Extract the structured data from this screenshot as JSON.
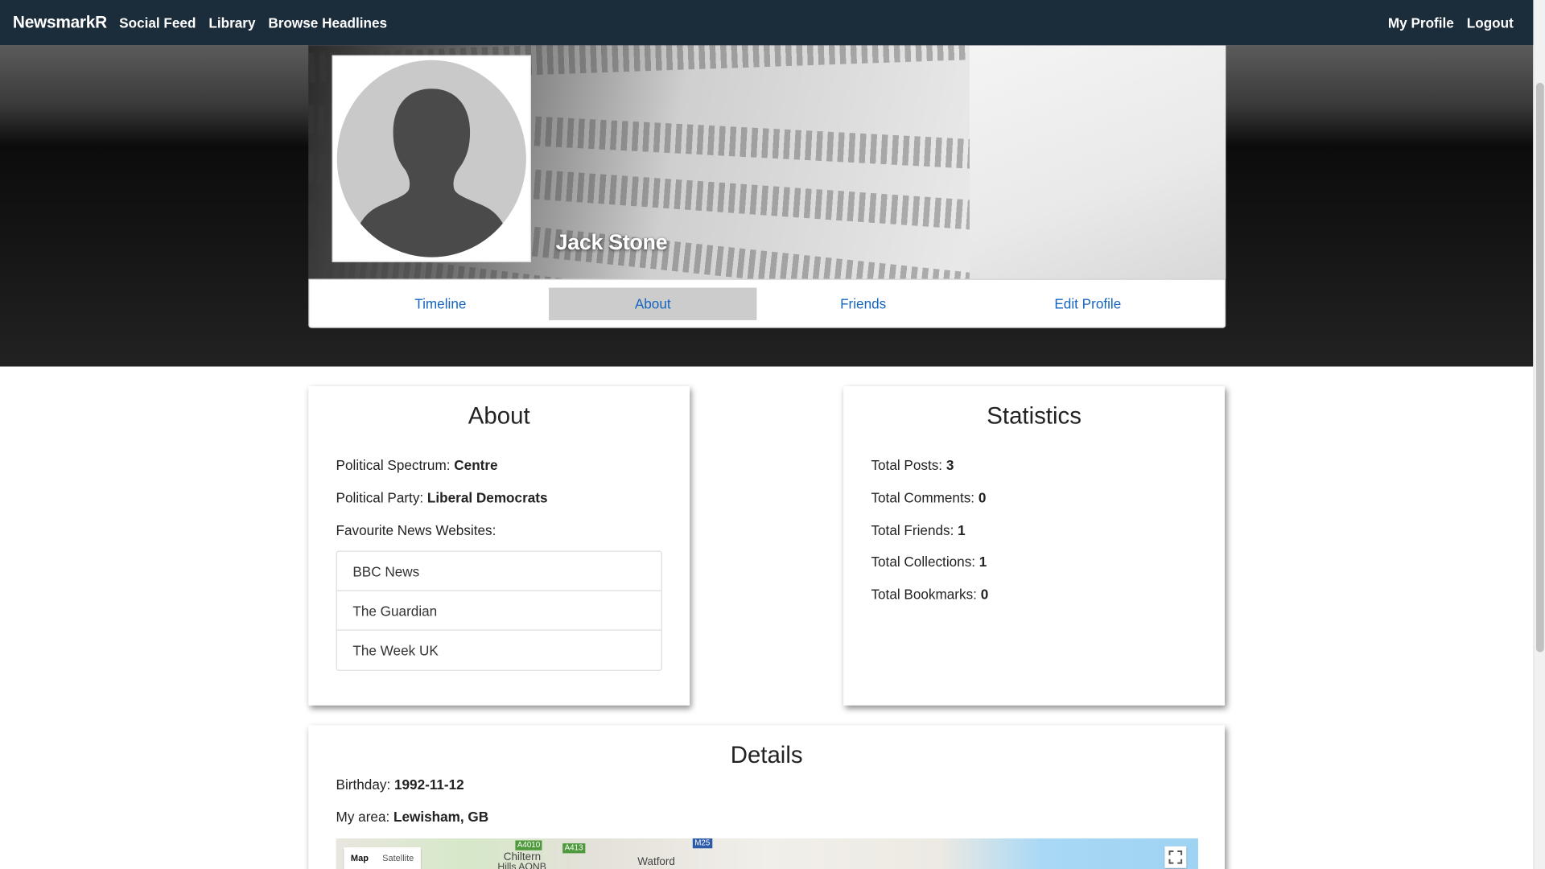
{
  "navbar": {
    "brand": "NewsmarkR",
    "left_links": [
      "Social Feed",
      "Library",
      "Browse Headlines"
    ],
    "right_links": [
      "My Profile",
      "Logout"
    ]
  },
  "profile": {
    "name": "Jack Stone"
  },
  "tabs": [
    "Timeline",
    "About",
    "Friends",
    "Edit Profile"
  ],
  "active_tab": "About",
  "about": {
    "title": "About",
    "political_spectrum_label": "Political Spectrum:",
    "political_spectrum_value": "Centre",
    "political_party_label": "Political Party:",
    "political_party_value": "Liberal Democrats",
    "favourite_sites_label": "Favourite News Websites:",
    "favourite_sites": [
      "BBC News",
      "The Guardian",
      "The Week UK"
    ]
  },
  "statistics": {
    "title": "Statistics",
    "items": [
      {
        "label": "Total Posts:",
        "value": "3"
      },
      {
        "label": "Total Comments:",
        "value": "0"
      },
      {
        "label": "Total Friends:",
        "value": "1"
      },
      {
        "label": "Total Collections:",
        "value": "1"
      },
      {
        "label": "Total Bookmarks:",
        "value": "0"
      }
    ]
  },
  "details": {
    "title": "Details",
    "birthday_label": "Birthday:",
    "birthday_value": "1992-11-12",
    "area_label": "My area:",
    "area_value": "Lewisham, GB"
  },
  "map": {
    "toggle_map": "Map",
    "toggle_satellite": "Satellite",
    "place_labels": [
      "Chiltern",
      "Hills AONB",
      "Watford"
    ],
    "road_labels": [
      "A4010",
      "A413",
      "M25"
    ]
  },
  "colors": {
    "navbar_bg": "#1b2c3b",
    "link_blue": "#1565c0",
    "active_tab_bg": "#cccccc"
  }
}
